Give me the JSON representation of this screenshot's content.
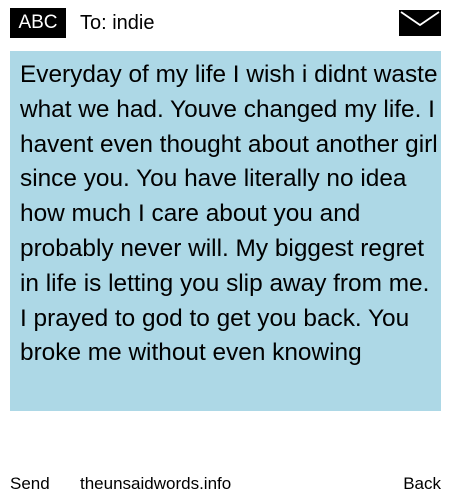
{
  "header": {
    "input_mode": "ABC",
    "recipient": "To: indie",
    "icon": "envelope-icon"
  },
  "message": {
    "text": "Everyday of my life I wish i didnt waste what we had. Youve changed my life. I havent even thought about another girl since you. You have literally no idea how much I care about you and probably never will. My biggest regret in life is letting you slip away from me. I prayed to god to get you back. You broke me without even knowing",
    "background_color": "#add8e6"
  },
  "footer": {
    "left_softkey": "Send",
    "center_label": "theunsaidwords.info",
    "right_softkey": "Back"
  }
}
